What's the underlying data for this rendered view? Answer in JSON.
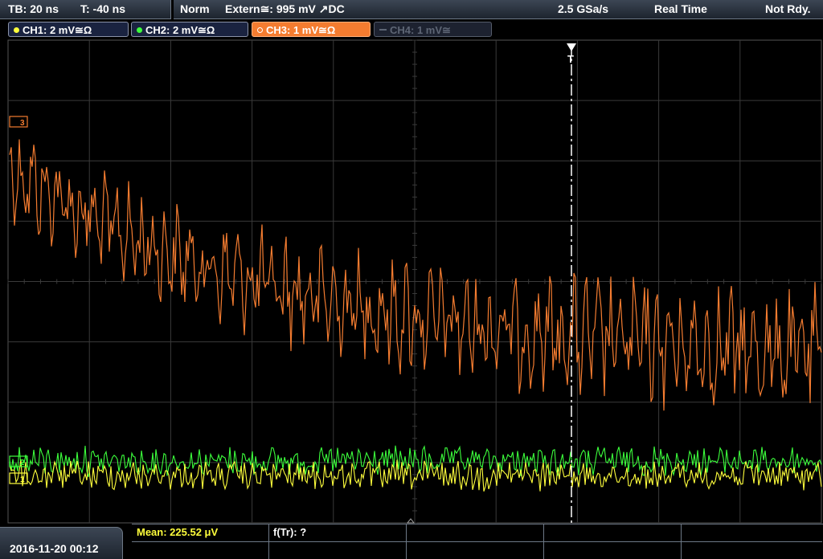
{
  "status": {
    "timebase": "TB: 20 ns",
    "trigger_time": "T: -40 ns",
    "mode": "Norm",
    "trigger_source": "Extern≅: 995 mV ↗DC",
    "sample_rate": "2.5 GSa/s",
    "acquisition": "Real Time",
    "state": "Not Rdy."
  },
  "channels": [
    {
      "label": "CH1: 2 mV≅Ω",
      "color": "#ffff3c",
      "active": true
    },
    {
      "label": "CH2: 2 mV≅Ω",
      "color": "#3cff3c",
      "active": true
    },
    {
      "label": "CH3: 1 mV≅Ω",
      "color": "#f47c30",
      "active": true,
      "selected": true
    },
    {
      "label": "CH4: 1 mV≅",
      "color": "#5d6574",
      "active": false
    }
  ],
  "markers": {
    "ch3": "3",
    "ch2": "2",
    "ch1": "1",
    "trigger": "T"
  },
  "measurements": {
    "mean": "Mean: 225.52 μV",
    "ftr": "f(Tr): ?"
  },
  "datetime": "2016-11-20 00:12",
  "colors": {
    "grid": "#3a3a3a",
    "ch1": "#ffff3c",
    "ch2": "#3cff3c",
    "ch3": "#f47c30",
    "trigger": "#ffffff"
  }
}
